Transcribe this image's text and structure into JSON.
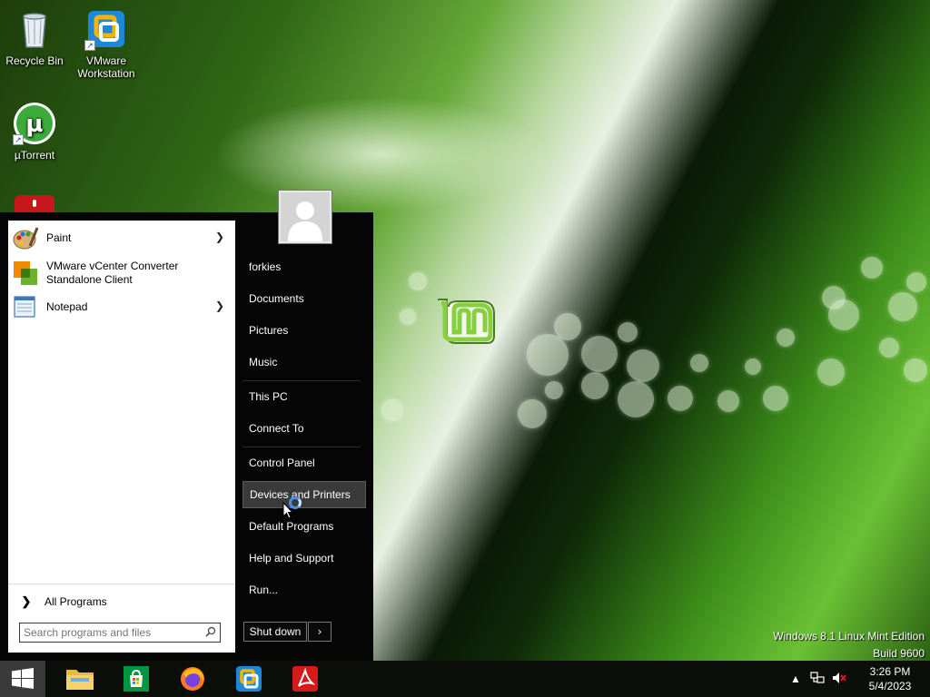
{
  "desktop": {
    "icons": [
      {
        "label": "Recycle Bin",
        "icon": "recycle-bin-icon"
      },
      {
        "label": "VMware Workstation",
        "icon": "vmware-icon"
      },
      {
        "label": "µTorrent",
        "icon": "utorrent-icon"
      }
    ],
    "watermark": {
      "line1": "Windows 8.1 Linux Mint Edition",
      "line2": "Build 9600"
    }
  },
  "start_menu": {
    "programs": [
      {
        "label": "Paint",
        "icon": "paint-icon",
        "has_submenu": true
      },
      {
        "label": "VMware vCenter Converter Standalone Client",
        "icon": "vcenter-converter-icon",
        "has_submenu": false
      },
      {
        "label": "Notepad",
        "icon": "notepad-icon",
        "has_submenu": true
      }
    ],
    "all_programs": "All Programs",
    "search_placeholder": "Search programs and files",
    "right_items": [
      {
        "label": "forkies"
      },
      {
        "label": "Documents"
      },
      {
        "label": "Pictures"
      },
      {
        "label": "Music"
      },
      {
        "label": "This PC"
      },
      {
        "label": "Connect To"
      },
      {
        "label": "Control Panel"
      },
      {
        "label": "Devices and Printers",
        "highlighted": true
      },
      {
        "label": "Default Programs"
      },
      {
        "label": "Help and Support"
      },
      {
        "label": "Run..."
      }
    ],
    "shutdown_label": "Shut down",
    "shutdown_arrow": "›"
  },
  "taskbar": {
    "pinned": [
      "file-explorer-icon",
      "store-icon",
      "firefox-icon",
      "vmware-icon",
      "acrobat-icon"
    ],
    "tray": {
      "time": "3:26 PM",
      "date": "5/4/2023"
    }
  },
  "colors": {
    "menu_bg": "#050505",
    "hover_bg": "#3a3a3a",
    "mint_green": "#87cf3e"
  }
}
